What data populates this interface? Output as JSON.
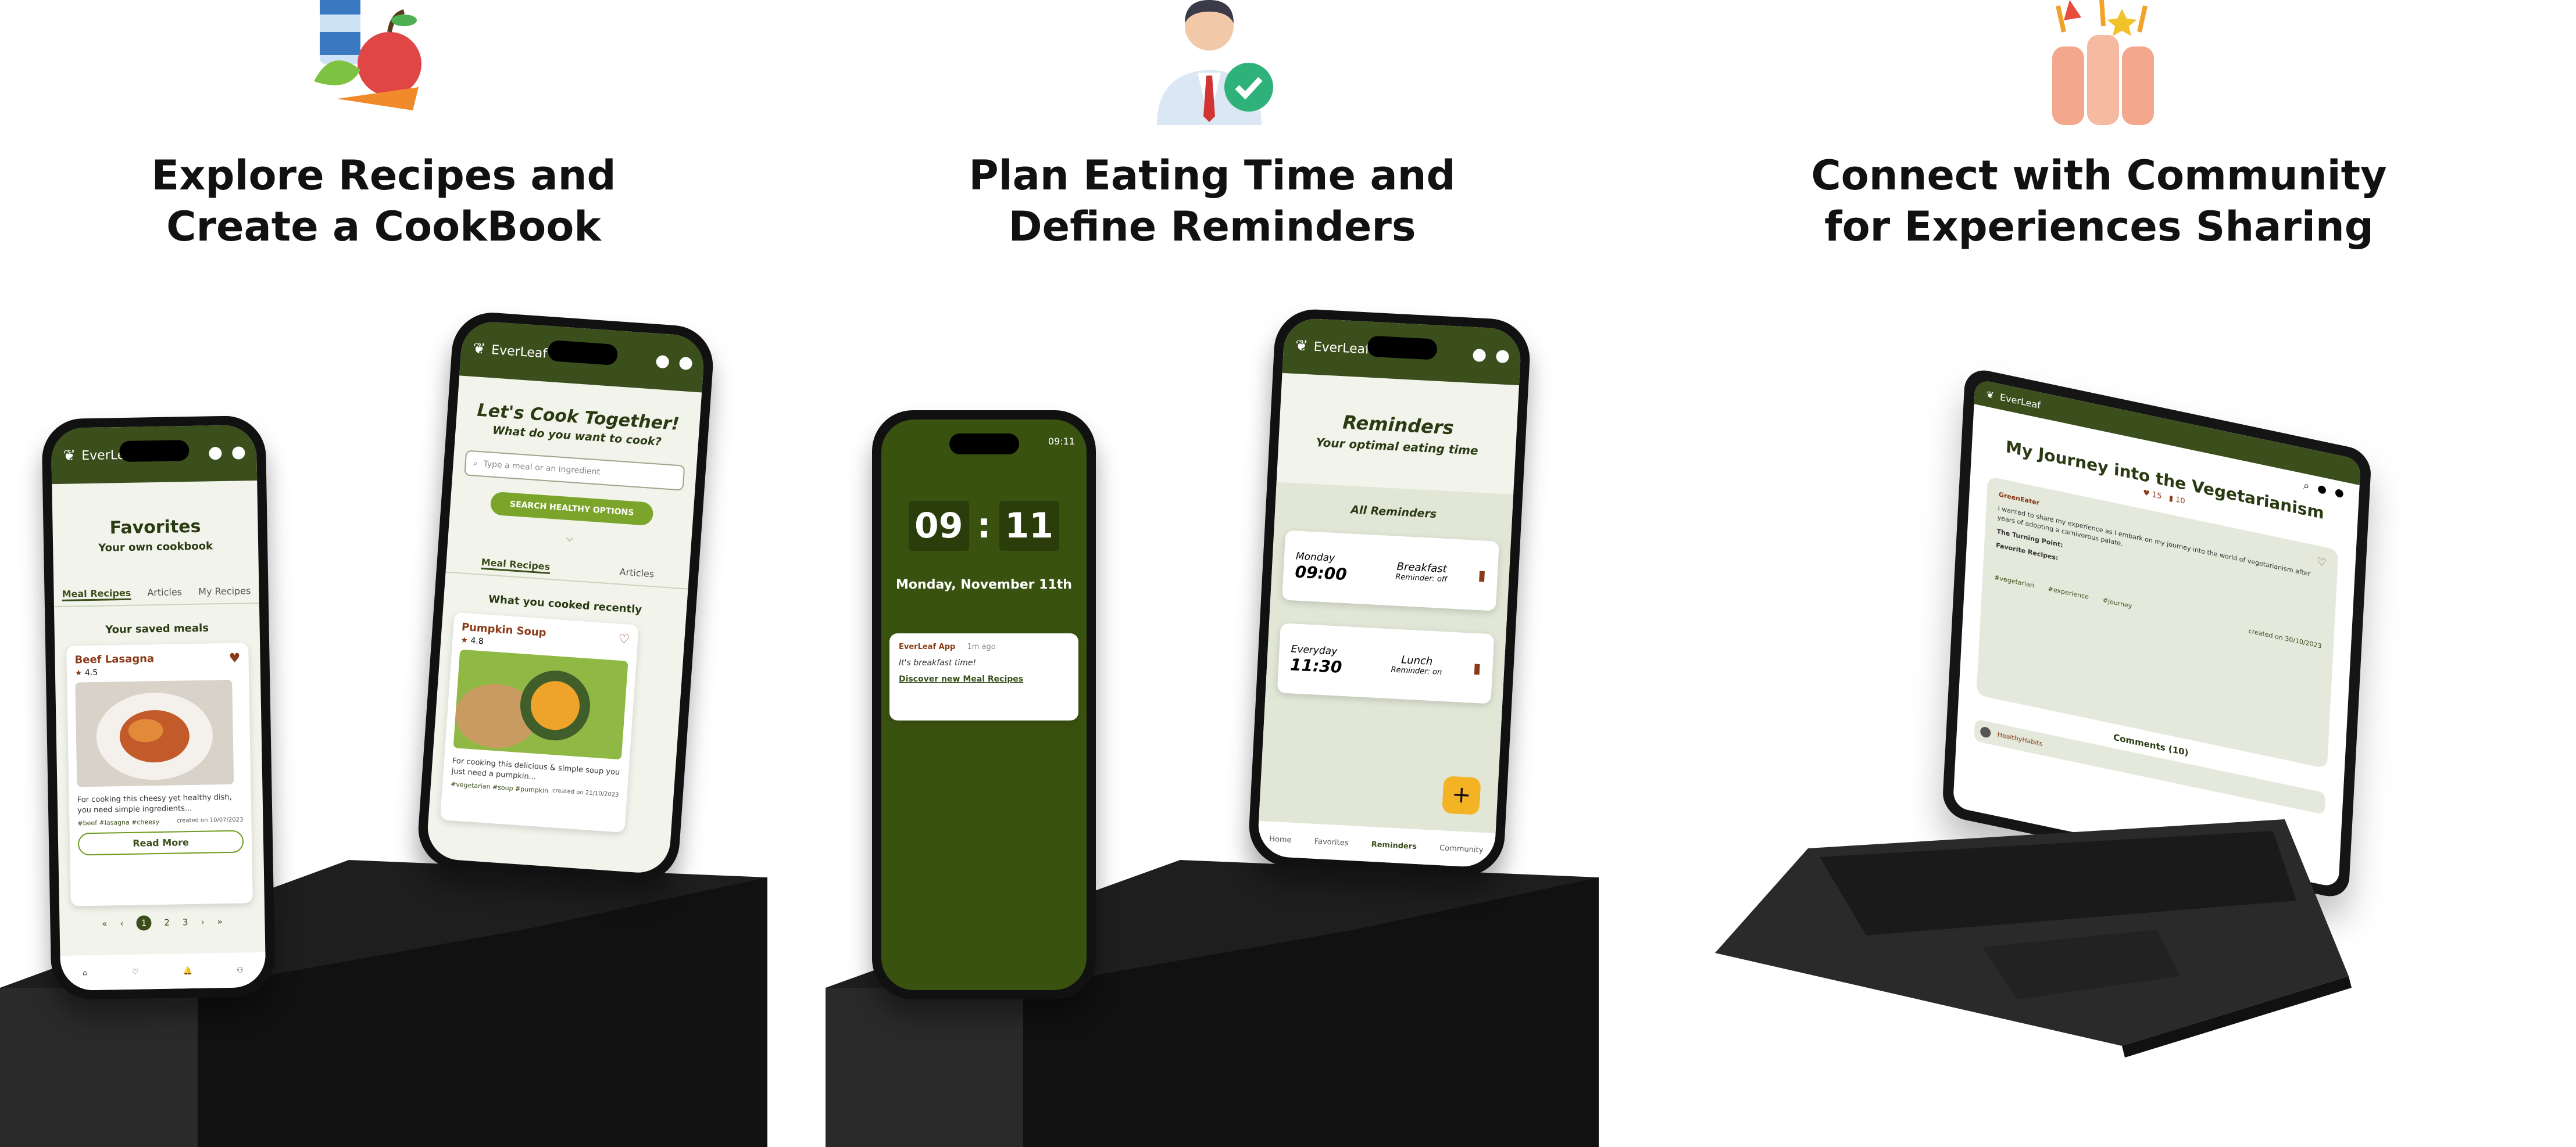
{
  "panels": [
    {
      "heading_line1": "Explore Recipes and",
      "heading_line2": "Create a CookBook",
      "icon": "groceries-icon",
      "phone_favorites": {
        "brand": "EverLeaf",
        "title": "Favorites",
        "subtitle": "Your own cookbook",
        "tabs": [
          "Meal Recipes",
          "Articles",
          "My Recipes"
        ],
        "section": "Your saved meals",
        "card_title": "Beef Lasagna",
        "card_rating": "4.5",
        "card_desc": "For cooking this cheesy yet healthy dish, you need simple ingredients...",
        "card_tags": "#beef #lasagna #cheesy",
        "card_date": "created on 10/07/2023",
        "card_button": "Read More",
        "pages": [
          "1",
          "2",
          "3"
        ]
      },
      "phone_cook": {
        "brand": "EverLeaf",
        "title": "Let's Cook Together!",
        "subtitle": "What do you want to cook?",
        "search_placeholder": "Type a meal or an ingredient",
        "button": "SEARCH HEALTHY OPTIONS",
        "tabs": [
          "Meal Recipes",
          "Articles"
        ],
        "section": "What you cooked recently",
        "card_title": "Pumpkin Soup",
        "card_rating": "4.8",
        "card_desc": "For cooking this delicious & simple soup you just need a pumpkin...",
        "card_tags": "#vegetarian #soup #pumpkin",
        "card_date": "created on 21/10/2023"
      }
    },
    {
      "heading_line1": "Plan Eating Time and",
      "heading_line2": "Define Reminders",
      "icon": "verified-person-icon",
      "phone_lock": {
        "status_time": "09:11",
        "clock_h": "09",
        "clock_m": "11",
        "date": "Monday, November 11th",
        "notif_app": "EverLeaf App",
        "notif_time": "1m ago",
        "notif_msg": "It's breakfast time!",
        "notif_link": "Discover new Meal Recipes"
      },
      "phone_reminders": {
        "brand": "EverLeaf",
        "title": "Reminders",
        "subtitle": "Your optimal eating time",
        "section": "All Reminders",
        "items": [
          {
            "day": "Monday",
            "time": "09:00",
            "meal": "Breakfast",
            "status": "Reminder: off"
          },
          {
            "day": "Everyday",
            "time": "11:30",
            "meal": "Lunch",
            "status": "Reminder: on"
          }
        ],
        "fab": "+",
        "nav": [
          "Home",
          "Favorites",
          "Reminders",
          "Community"
        ]
      }
    },
    {
      "heading_line1": "Connect with Community",
      "heading_line2": "for Experiences Sharing",
      "icon": "raised-fists-icon",
      "tablet": {
        "brand": "EverLeaf",
        "title": "My Journey into the Vegetarianism",
        "likes": "15",
        "saves": "10",
        "author": "GreenEater",
        "body": "I wanted to share my experience as I embark on my journey into the world of vegetarianism after years of adopting a carnivorous palate.",
        "subhead1": "The Turning Point:",
        "subhead2": "Favorite Recipes:",
        "tags": [
          "#vegetarian",
          "#experience",
          "#journey"
        ],
        "date": "created on 30/10/2023",
        "comments": "Comments (10)",
        "commenter": "HealthyHabits"
      }
    }
  ],
  "colors": {
    "accent": "#3b4f1c",
    "button": "#7aa52a",
    "brown": "#8a3a16",
    "fab": "#f4b324"
  }
}
